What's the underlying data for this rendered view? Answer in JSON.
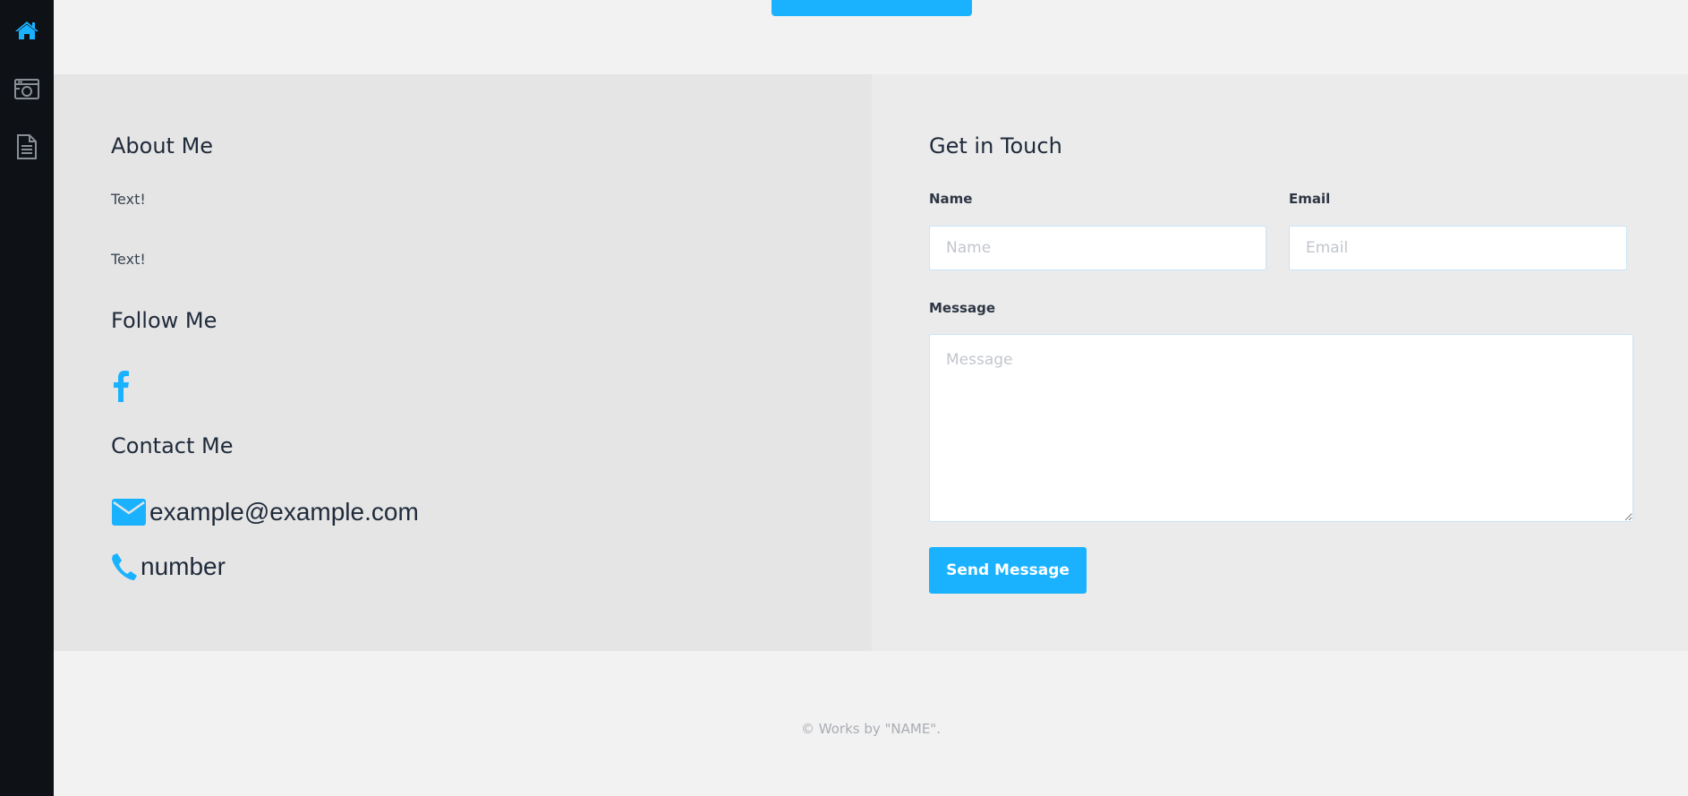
{
  "sidebar": {
    "items": [
      {
        "icon": "home-icon",
        "active": true
      },
      {
        "icon": "camera-icon",
        "active": false
      },
      {
        "icon": "document-icon",
        "active": false
      }
    ]
  },
  "about": {
    "heading": "About Me",
    "paragraphs": [
      "Text!",
      "Text!"
    ]
  },
  "follow": {
    "heading": "Follow Me",
    "icons": [
      "facebook-icon"
    ]
  },
  "contact": {
    "heading": "Contact Me",
    "email": "example@example.com",
    "phone": "number"
  },
  "form": {
    "heading": "Get in Touch",
    "name_label": "Name",
    "name_placeholder": "Name",
    "email_label": "Email",
    "email_placeholder": "Email",
    "message_label": "Message",
    "message_placeholder": "Message",
    "submit_label": "Send Message"
  },
  "footer": {
    "copyright": "© Works by \"NAME\"."
  },
  "colors": {
    "accent": "#1ab2ff",
    "sidebar_bg": "#0e1216",
    "left_panel_bg": "#e5e5e5",
    "right_panel_bg": "#ebebeb",
    "page_bg": "#f2f2f2"
  }
}
